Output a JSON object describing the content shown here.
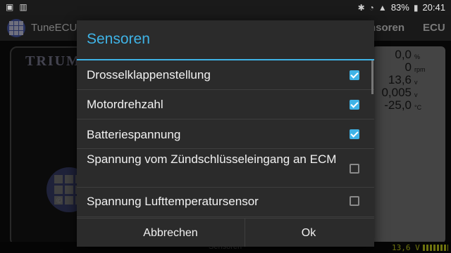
{
  "status_bar": {
    "battery": "83%",
    "time": "20:41"
  },
  "app_bar": {
    "title": "TuneECU",
    "tab_partial": "nsoren",
    "tab_ecu": "ECU"
  },
  "background": {
    "brand": "TRIUM",
    "copyright": "©",
    "readouts": [
      {
        "value": "0,0",
        "unit": "%"
      },
      {
        "value": "0",
        "unit": "rpm"
      },
      {
        "value": "13,6",
        "unit": "v"
      },
      {
        "value": "0,005",
        "unit": "v"
      },
      {
        "value": "-25,0",
        "unit": "°C"
      }
    ],
    "bottom_label": "Sensoren",
    "bottom_voltage": "13,6 V"
  },
  "dialog": {
    "title": "Sensoren",
    "items": [
      {
        "label": "Drosselklappenstellung",
        "checked": true
      },
      {
        "label": "Motordrehzahl",
        "checked": true
      },
      {
        "label": "Batteriespannung",
        "checked": true
      },
      {
        "label": "Spannung vom Zündschlüsseleingang an ECM",
        "checked": false
      },
      {
        "label": "Spannung Lufttemperatursensor",
        "checked": false
      }
    ],
    "cancel_label": "Abbrechen",
    "ok_label": "Ok"
  },
  "colors": {
    "accent": "#3fb3e6",
    "dialog_bg": "#2b2b2b"
  }
}
